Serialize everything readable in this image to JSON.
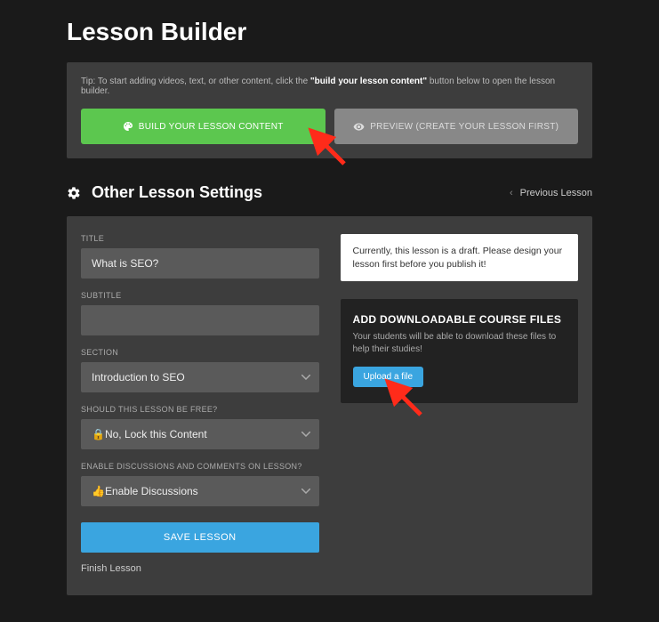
{
  "page_title": "Lesson Builder",
  "tip": {
    "prefix": "Tip: To start adding videos, text, or other content, click the ",
    "bold": "\"build your lesson content\"",
    "suffix": " button below to open the lesson builder."
  },
  "buttons": {
    "build": "BUILD YOUR LESSON CONTENT",
    "preview": "PREVIEW (CREATE YOUR LESSON FIRST)"
  },
  "settings_header": "Other Lesson Settings",
  "prev_link": "Previous Lesson",
  "fields": {
    "title_label": "TITLE",
    "title_value": "What is SEO?",
    "subtitle_label": "SUBTITLE",
    "subtitle_value": "",
    "section_label": "SECTION",
    "section_value": "Introduction to SEO",
    "free_label": "SHOULD THIS LESSON BE FREE?",
    "free_value": "🔒No, Lock this Content",
    "discussions_label": "ENABLE DISCUSSIONS AND COMMENTS ON LESSON?",
    "discussions_value": "👍Enable Discussions"
  },
  "save_button": "SAVE LESSON",
  "finish_link": "Finish Lesson",
  "draft_notice": "Currently, this lesson is a draft. Please design your lesson first before you publish it!",
  "files": {
    "title": "ADD DOWNLOADABLE COURSE FILES",
    "desc": "Your students will be able to download these files to help their studies!",
    "upload": "Upload a file"
  }
}
